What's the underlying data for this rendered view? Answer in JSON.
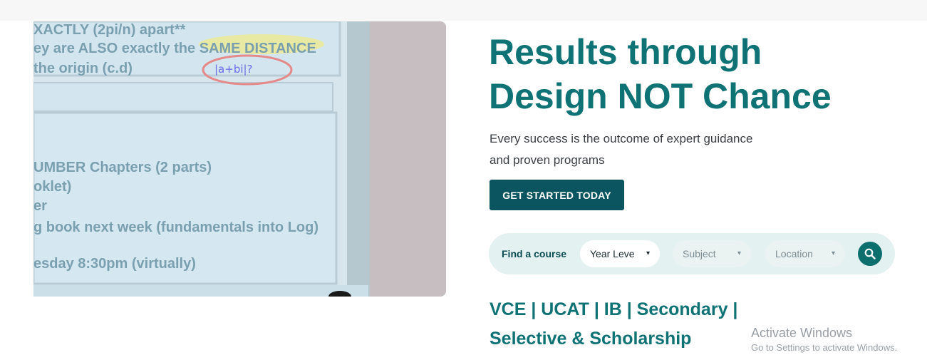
{
  "hero": {
    "title_line1": "Results through",
    "title_line2": "Design NOT Chance",
    "subtitle_line1": "Every success is the outcome of expert guidance",
    "subtitle_line2": "and proven programs",
    "cta_label": "GET STARTED TODAY"
  },
  "whiteboard": {
    "line1": "XACTLY (2pi/n) apart**",
    "line2": "ey are ALSO exactly the SAME DISTANCE",
    "line3": "the origin (c.d)",
    "note": "|a+bi|?",
    "line4": "UMBER Chapters (2 parts)",
    "line5": "oklet)",
    "line6": "er",
    "line7": "g book next week (fundamentals into Log)",
    "line8": "esday 8:30pm (virtually)"
  },
  "course_finder": {
    "label": "Find a course",
    "year_level": "Year Leve",
    "subject": "Subject",
    "location": "Location",
    "caret": "▾",
    "search_icon": "magnifier-icon"
  },
  "programs": {
    "line1": "VCE | UCAT | IB | Secondary |",
    "line2": "Selective & Scholarship"
  },
  "watermark": {
    "title": "Activate Windows",
    "subtitle": "Go to Settings to activate Windows."
  },
  "colors": {
    "brand_teal": "#0f7275",
    "button_dark": "#0b5561",
    "finder_bg": "#e3f1f0"
  }
}
